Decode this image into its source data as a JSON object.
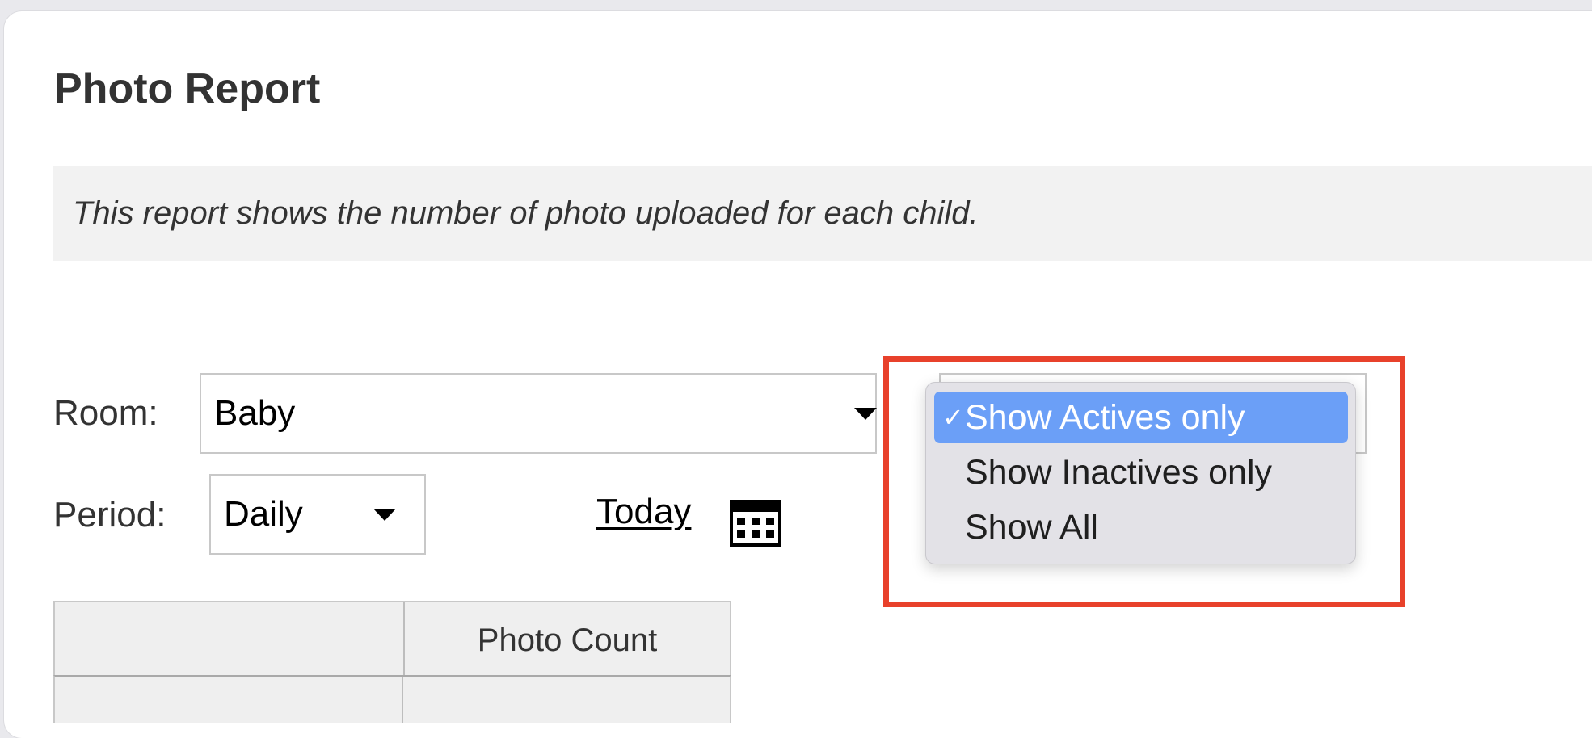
{
  "page": {
    "title": "Photo Report",
    "description": "This report shows the number of photo uploaded for each child."
  },
  "filters": {
    "room_label": "Room:",
    "room_value": "Baby",
    "period_label": "Period:",
    "period_value": "Daily",
    "date_link": "Today"
  },
  "status_dropdown": {
    "options": [
      {
        "label": "Show Actives only",
        "selected": true
      },
      {
        "label": "Show Inactives only",
        "selected": false
      },
      {
        "label": "Show All",
        "selected": false
      }
    ],
    "check_glyph": "✓"
  },
  "table": {
    "headers": [
      "",
      "Photo Count"
    ]
  },
  "colors": {
    "highlight": "#e8412b",
    "selected_option": "#6b9ff7"
  },
  "icons": {
    "calendar": "calendar-icon",
    "room_caret": "caret-down-icon",
    "period_caret": "caret-down-icon"
  }
}
